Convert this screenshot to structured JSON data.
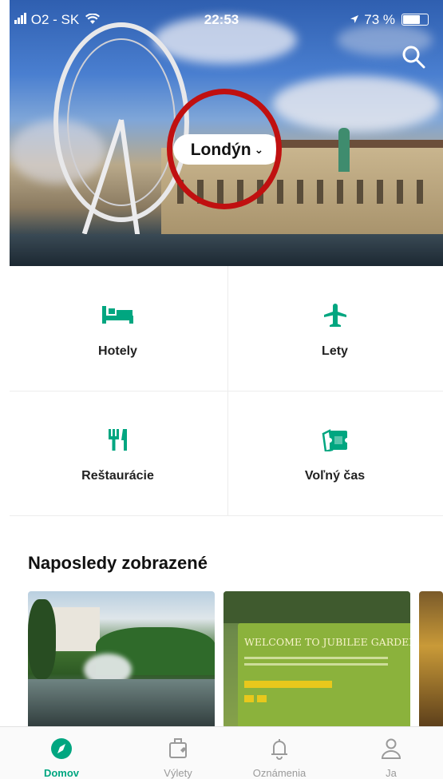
{
  "status_bar": {
    "carrier": "O2 - SK",
    "time": "22:53",
    "battery": "73 %",
    "battery_level": 0.73
  },
  "hero": {
    "city": "Londýn"
  },
  "categories": [
    {
      "label": "Hotely",
      "icon": "bed-icon"
    },
    {
      "label": "Lety",
      "icon": "airplane-icon"
    },
    {
      "label": "Reštaurácie",
      "icon": "fork-knife-icon"
    },
    {
      "label": "Voľný čas",
      "icon": "ticket-icon"
    }
  ],
  "recent": {
    "title": "Naposledy zobrazené",
    "cards": [
      {
        "name": "park-lake-photo"
      },
      {
        "name": "jubilee-gardens-photo",
        "sign_text": "WELCOME TO JUBILEE GARDEN"
      },
      {
        "name": "partial-photo"
      }
    ]
  },
  "tabbar": {
    "tabs": [
      {
        "label": "Domov",
        "icon": "compass-icon",
        "active": true
      },
      {
        "label": "Výlety",
        "icon": "suitcase-icon",
        "active": false
      },
      {
        "label": "Oznámenia",
        "icon": "bell-icon",
        "active": false
      },
      {
        "label": "Ja",
        "icon": "person-icon",
        "active": false
      }
    ]
  },
  "colors": {
    "accent": "#00a680",
    "highlight_ring": "#c01010"
  }
}
